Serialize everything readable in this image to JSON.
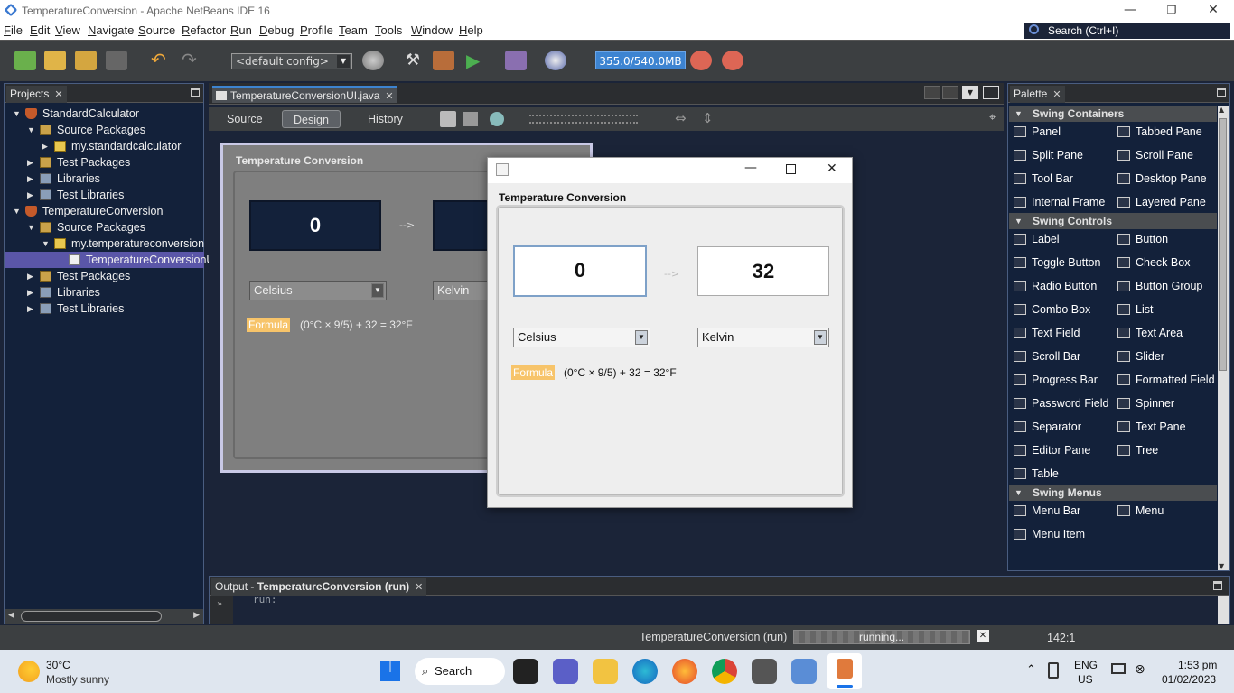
{
  "window": {
    "title": "TemperatureConversion - Apache NetBeans IDE 16"
  },
  "menu": [
    "File",
    "Edit",
    "View",
    "Navigate",
    "Source",
    "Refactor",
    "Run",
    "Debug",
    "Profile",
    "Team",
    "Tools",
    "Window",
    "Help"
  ],
  "search": {
    "placeholder": "Search (Ctrl+I)"
  },
  "toolbar": {
    "config": "<default config>",
    "memory": "355.0/540.0MB"
  },
  "projects": {
    "tab": "Projects",
    "tree": [
      {
        "label": "StandardCalculator",
        "icon": "project-icon",
        "level": 0,
        "expanded": true
      },
      {
        "label": "Source Packages",
        "icon": "folder-icon",
        "level": 1,
        "expanded": true
      },
      {
        "label": "my.standardcalculator",
        "icon": "package-icon",
        "level": 2,
        "expanded": false
      },
      {
        "label": "Test Packages",
        "icon": "folder-icon",
        "level": 1,
        "expanded": false
      },
      {
        "label": "Libraries",
        "icon": "library-icon",
        "level": 1,
        "expanded": false
      },
      {
        "label": "Test Libraries",
        "icon": "library-icon",
        "level": 1,
        "expanded": false
      },
      {
        "label": "TemperatureConversion",
        "icon": "project-icon",
        "level": 0,
        "expanded": true
      },
      {
        "label": "Source Packages",
        "icon": "folder-icon",
        "level": 1,
        "expanded": true
      },
      {
        "label": "my.temperatureconversion",
        "icon": "package-icon",
        "level": 2,
        "expanded": true
      },
      {
        "label": "TemperatureConversionUI.java",
        "icon": "java-file-icon",
        "level": 3,
        "selected": true
      },
      {
        "label": "Test Packages",
        "icon": "folder-icon",
        "level": 1,
        "expanded": false
      },
      {
        "label": "Libraries",
        "icon": "library-icon",
        "level": 1,
        "expanded": false
      },
      {
        "label": "Test Libraries",
        "icon": "library-icon",
        "level": 1,
        "expanded": false
      }
    ]
  },
  "editor": {
    "file_tab": "TemperatureConversionUI.java",
    "view_tabs": [
      "Source",
      "Design",
      "History"
    ],
    "active_view": "Design"
  },
  "design_form": {
    "title": "Temperature Conversion",
    "input_value": "0",
    "arrow": "-->",
    "from_unit": "Celsius",
    "to_unit": "Kelvin",
    "formula_label": "Formula",
    "formula_text": "(0°C × 9/5) + 32 = 32°F"
  },
  "run_window": {
    "title": "Temperature Conversion",
    "input_value": "0",
    "output_value": "32",
    "arrow": "-->",
    "from_unit": "Celsius",
    "to_unit": "Kelvin",
    "formula_label": "Formula",
    "formula_text": "(0°C × 9/5) + 32 = 32°F"
  },
  "palette": {
    "tab": "Palette",
    "swing_containers": {
      "label": "Swing Containers",
      "items": [
        "Panel",
        "Tabbed Pane",
        "Split Pane",
        "Scroll Pane",
        "Tool Bar",
        "Desktop Pane",
        "Internal Frame",
        "Layered Pane"
      ]
    },
    "swing_controls": {
      "label": "Swing Controls",
      "items": [
        "Label",
        "Button",
        "Toggle Button",
        "Check Box",
        "Radio Button",
        "Button Group",
        "Combo Box",
        "List",
        "Text Field",
        "Text Area",
        "Scroll Bar",
        "Slider",
        "Progress Bar",
        "Formatted Field",
        "Password Field",
        "Spinner",
        "Separator",
        "Text Pane",
        "Editor Pane",
        "Tree",
        "Table"
      ]
    },
    "swing_menus": {
      "label": "Swing Menus",
      "items": [
        "Menu Bar",
        "Menu",
        "Menu Item"
      ]
    }
  },
  "output": {
    "prefix": "Output - ",
    "title": "TemperatureConversion (run)",
    "text": "run:"
  },
  "status": {
    "task": "TemperatureConversion (run)",
    "progress": "running...",
    "position": "142:1"
  },
  "taskbar": {
    "weather_temp": "30°C",
    "weather_desc": "Mostly sunny",
    "search": "Search",
    "lang": "ENG",
    "region": "US",
    "time": "1:53 pm",
    "date": "01/02/2023"
  },
  "colors": {
    "accent": "#3d84d1",
    "formula_badge": "#f7c46a",
    "selection": "#5a56a8"
  }
}
